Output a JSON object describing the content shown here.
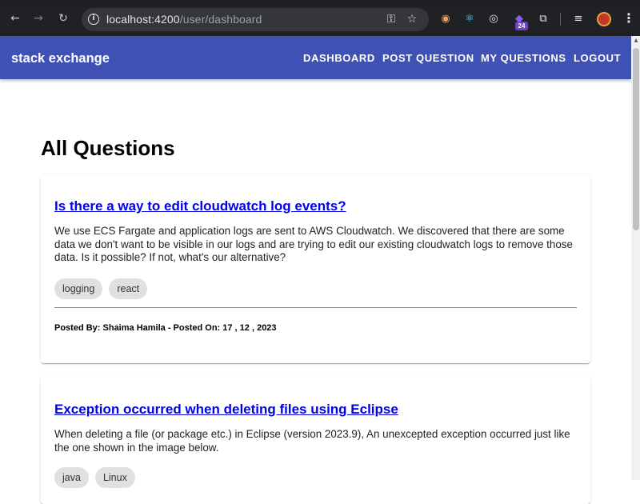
{
  "browser": {
    "url_host": "localhost:4200",
    "url_path": "/user/dashboard",
    "extension_badge": "24"
  },
  "header": {
    "brand": "stack exchange",
    "nav": [
      "DASHBOARD",
      "POST QUESTION",
      "MY QUESTIONS",
      "LOGOUT"
    ],
    "color": "#3f51b5"
  },
  "main": {
    "title": "All Questions",
    "questions": [
      {
        "title": "Is there a way to edit cloudwatch log events?",
        "body": "We use ECS Fargate and application logs are sent to AWS Cloudwatch. We discovered that there are some data we don't want to be visible in our logs and are trying to edit our existing cloudwatch logs to remove those data. Is it possible? If not, what's our alternative?",
        "tags": [
          "logging",
          "react"
        ],
        "posted": "Posted By: Shaima Hamila - Posted On: 17 , 12 , 2023"
      },
      {
        "title": "Exception occurred when deleting files using Eclipse",
        "body": "When deleting a file (or package etc.) in Eclipse (version 2023.9), An unexcepted exception occurred just like the one shown in the image below.",
        "tags": [
          "java",
          "Linux"
        ]
      }
    ]
  },
  "colors": {
    "link": "#0000ee",
    "tag_bg": "#e0e0e0"
  }
}
